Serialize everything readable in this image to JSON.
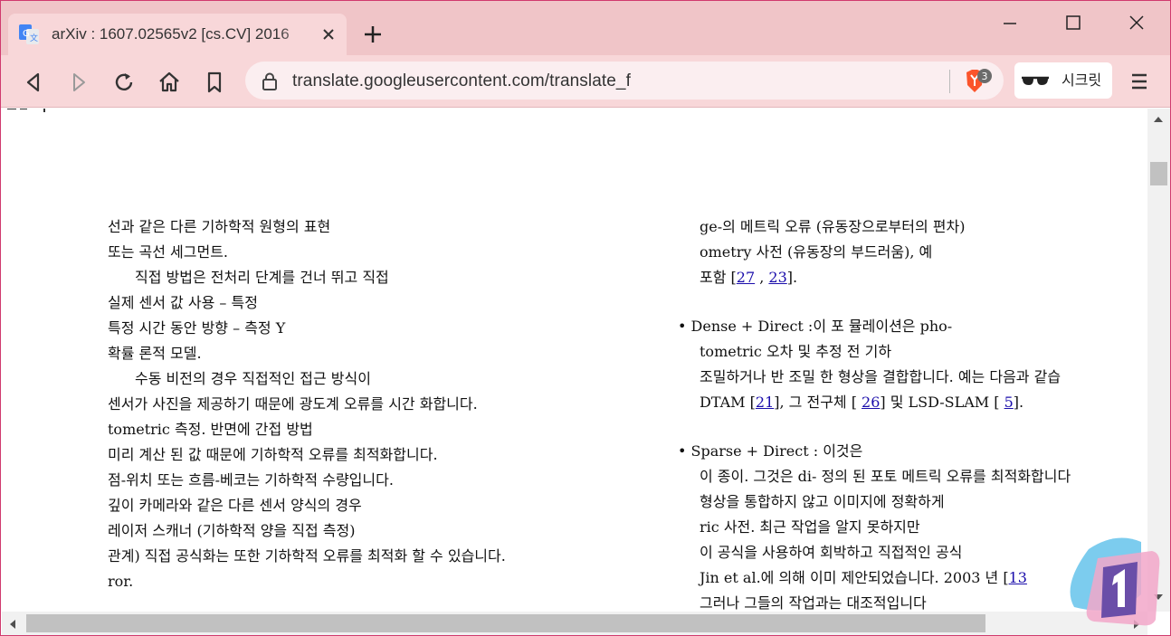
{
  "tab": {
    "title": "arXiv : 1607.02565v2  [cs.CV]  2016",
    "favicon": "google-translate-icon"
  },
  "toolbar": {
    "url": "translate.googleusercontent.com/translate_f",
    "shield_count": "3",
    "incognito_label": "시크릿"
  },
  "colors": {
    "accent_border": "#d03a6e",
    "tab_strip": "#f0c5c8",
    "toolbar": "#f8d7d9",
    "link": "#1a0dab"
  },
  "doc": {
    "left": [
      "선과 같은 다른 기하학적 원형의 표현",
      "또는 곡선 세그먼트.",
      "직접 방법은 전처리 단계를 건너 뛰고 직접",
      "실제 센서 값 사용 – 특정",
      "특정 시간 동안 방향 – 측정 Y",
      "확률 론적 모델.",
      "수동 비전의 경우 직접적인 접근 방식이",
      "센서가 사진을 제공하기 때문에 광도계 오류를 시간 화합니다.",
      "tometric 측정. 반면에 간접 방법",
      "미리 계산 된 값 때문에 기하학적 오류를 최적화합니다.",
      "점-위치 또는 흐름-베코는 기하학적 수량입니다.",
      "깊이 카메라와 같은 다른 센서 양식의 경우",
      "레이저 스캐너 (기하학적 양을 직접 측정)",
      "관계) 직접 공식화는 또한 기하학적 오류를 최적화 할 수 있습니다.",
      "ror."
    ],
    "right": {
      "b1_line1": "ge-의 메트릭 오류 (유동장으로부터의 편차)",
      "b1_line2": "ometry 사전 (유동장의 부드러움), 예",
      "b1_line3_a": "포함 [",
      "b1_ref1": "27",
      "b1_line3_b": " , ",
      "b1_ref2": "23",
      "b1_line3_c": "].",
      "b2_line1": "• Dense + Direct :이 포 뮬레이션은 pho-",
      "b2_line2": "tometric 오차 및 추정 전 기하",
      "b2_line3": "조밀하거나 반 조밀 한 형상을 결합합니다. 예는 다음과 같습",
      "b2_line4_a": "DTAM [",
      "b2_ref1": "21",
      "b2_line4_b": "], 그 전구체 [ ",
      "b2_ref2": "26",
      "b2_line4_c": "] 및 LSD-SLAM [ ",
      "b2_ref3": "5",
      "b2_line4_d": "].",
      "b3_line1": "• Sparse + Direct : 이것은",
      "b3_line2": "이 종이. 그것은 di- 정의 된 포토 메트릭 오류를 최적화합니다",
      "b3_line3": "형상을 통합하지 않고 이미지에 정확하게",
      "b3_line4": "ric 사전. 최근 작업을 알지 못하지만",
      "b3_line5": "이 공식을 사용하여 회박하고 직접적인 공식",
      "b3_line6_a": "Jin et al.에 의해 이미 제안되었습니다. 2003 년 [",
      "b3_ref1": "13",
      "b3_line7": "그러나 그들의 작업과는 대조적입니다"
    }
  }
}
